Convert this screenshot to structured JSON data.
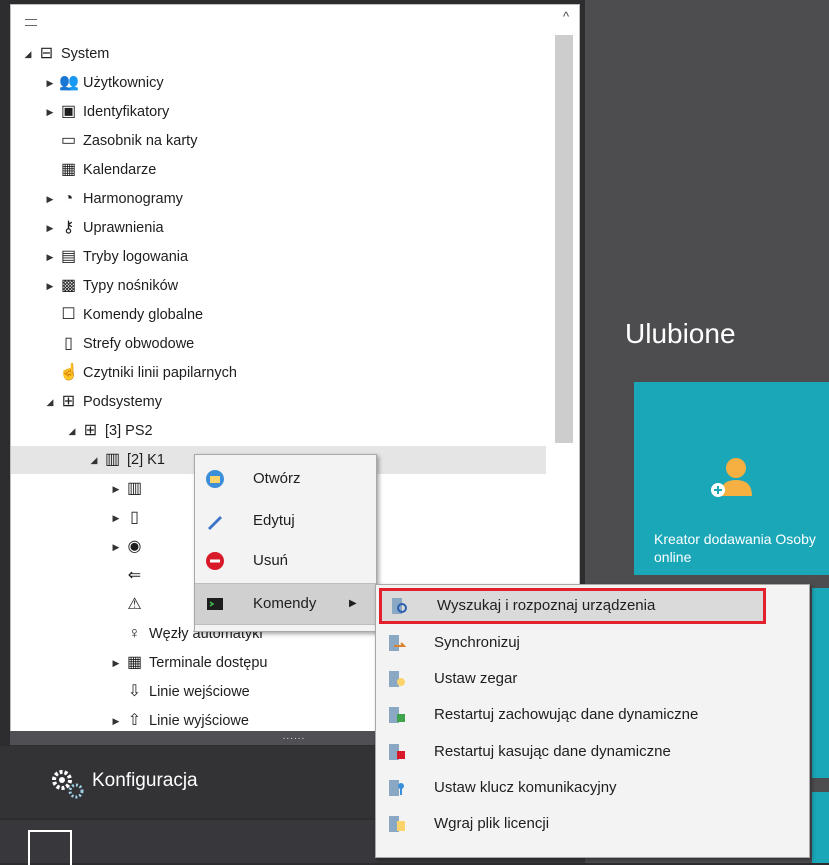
{
  "tree": {
    "items": [
      {
        "label": "System",
        "icon": "system-icon",
        "level": 0,
        "expander": "open"
      },
      {
        "label": "Użytkownicy",
        "icon": "users-icon",
        "level": 1,
        "expander": "closed"
      },
      {
        "label": "Identyfikatory",
        "icon": "id-card-icon",
        "level": 1,
        "expander": "closed"
      },
      {
        "label": "Zasobnik na karty",
        "icon": "card-holder-icon",
        "level": 1,
        "expander": "none"
      },
      {
        "label": "Kalendarze",
        "icon": "calendar-icon",
        "level": 1,
        "expander": "none"
      },
      {
        "label": "Harmonogramy",
        "icon": "clock-icon",
        "level": 1,
        "expander": "closed"
      },
      {
        "label": "Uprawnienia",
        "icon": "key-icon",
        "level": 1,
        "expander": "closed"
      },
      {
        "label": "Tryby logowania",
        "icon": "login-modes-icon",
        "level": 1,
        "expander": "closed"
      },
      {
        "label": "Typy nośników",
        "icon": "media-types-icon",
        "level": 1,
        "expander": "closed"
      },
      {
        "label": "Komendy globalne",
        "icon": "global-commands-icon",
        "level": 1,
        "expander": "none"
      },
      {
        "label": "Strefy obwodowe",
        "icon": "perimeter-zone-icon",
        "level": 1,
        "expander": "none"
      },
      {
        "label": "Czytniki linii papilarnych",
        "icon": "fingerprint-reader-icon",
        "level": 1,
        "expander": "none"
      },
      {
        "label": "Podsystemy",
        "icon": "subsystems-icon",
        "level": 1,
        "expander": "open"
      },
      {
        "label": "[3] PS2",
        "icon": "subsystem-icon",
        "level": 2,
        "expander": "open"
      },
      {
        "label": "[2] K1",
        "icon": "controller-icon",
        "level": 3,
        "expander": "open",
        "selected": true
      },
      {
        "label": "",
        "icon": "device-icon",
        "level": 4,
        "expander": "closed"
      },
      {
        "label": "",
        "icon": "door-icon",
        "level": 4,
        "expander": "closed"
      },
      {
        "label": "",
        "icon": "keypad-icon",
        "level": 4,
        "expander": "closed"
      },
      {
        "label": "",
        "icon": "input-icon",
        "level": 4,
        "expander": "none"
      },
      {
        "label": "",
        "icon": "alarm-icon",
        "level": 4,
        "expander": "none"
      },
      {
        "label": "Węzły automatyki",
        "icon": "automation-node-icon",
        "level": 4,
        "expander": "none"
      },
      {
        "label": "Terminale dostępu",
        "icon": "access-terminal-icon",
        "level": 4,
        "expander": "closed"
      },
      {
        "label": "Linie wejściowe",
        "icon": "input-lines-icon",
        "level": 4,
        "expander": "none"
      },
      {
        "label": "Linie wyjściowe",
        "icon": "output-lines-icon",
        "level": 4,
        "expander": "closed"
      }
    ]
  },
  "splitter_label": "......",
  "nav": {
    "configuration_label": "Konfiguracja"
  },
  "favorites": {
    "title": "Ulubione",
    "tile_label": "Kreator dodawania Osoby online"
  },
  "context_menu": {
    "items": [
      {
        "label": "Otwórz",
        "icon": "open-icon"
      },
      {
        "label": "Edytuj",
        "icon": "edit-icon"
      },
      {
        "label": "Usuń",
        "icon": "delete-icon"
      },
      {
        "label": "Komendy",
        "icon": "commands-icon",
        "submenu_arrow": "▶"
      }
    ]
  },
  "submenu": {
    "items": [
      {
        "label": "Wyszukaj i rozpoznaj urządzenia",
        "icon": "search-devices-icon"
      },
      {
        "label": "Synchronizuj",
        "icon": "synchronize-icon"
      },
      {
        "label": "Ustaw zegar",
        "icon": "set-clock-icon"
      },
      {
        "label": "Restartuj zachowując dane dynamiczne",
        "icon": "restart-keep-icon"
      },
      {
        "label": "Restartuj kasując dane dynamiczne",
        "icon": "restart-clear-icon"
      },
      {
        "label": "Ustaw klucz komunikacyjny",
        "icon": "set-key-icon"
      },
      {
        "label": "Wgraj plik licencji",
        "icon": "upload-license-icon"
      }
    ]
  },
  "colors": {
    "accent_tile": "#1aa7b8",
    "highlight_border": "#e3212e",
    "dark_panel": "#4d4d50"
  }
}
